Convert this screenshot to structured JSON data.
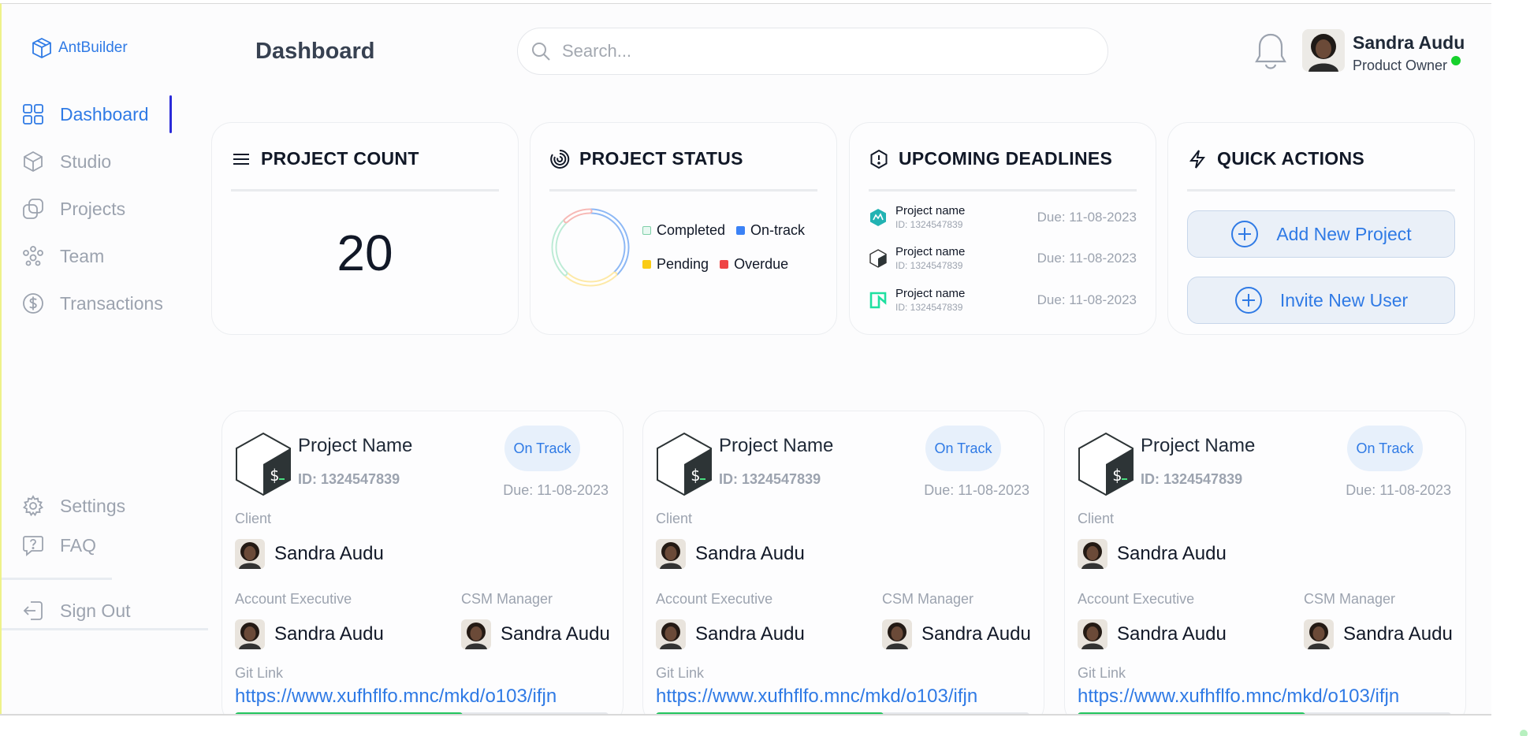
{
  "brand": {
    "name": "AntBuilder",
    "accent": "#2f7ae5"
  },
  "header": {
    "title": "Dashboard"
  },
  "search": {
    "placeholder": "Search..."
  },
  "user": {
    "name": "Sandra Audu",
    "role": "Product Owner",
    "status_color": "#16d12c"
  },
  "sidebar": {
    "items": [
      {
        "label": "Dashboard",
        "icon": "grid-icon",
        "active": true
      },
      {
        "label": "Studio",
        "icon": "cube-icon"
      },
      {
        "label": "Projects",
        "icon": "projects-icon"
      },
      {
        "label": "Team",
        "icon": "team-icon"
      },
      {
        "label": "Transactions",
        "icon": "dollar-icon"
      }
    ],
    "settings": "Settings",
    "faq": "FAQ",
    "signout": "Sign Out"
  },
  "cards": {
    "count": {
      "title": "PROJECT COUNT",
      "value": "20"
    },
    "status": {
      "title": "PROJECT STATUS",
      "legend": [
        {
          "label": "Completed",
          "color": "#a7e8c8"
        },
        {
          "label": "On-track",
          "color": "#3b82f6"
        },
        {
          "label": "Pending",
          "color": "#facc15"
        },
        {
          "label": "Overdue",
          "color": "#ef4444"
        }
      ],
      "segments": [
        {
          "label": "On-track",
          "fraction": 0.38,
          "color": "#8db8f5"
        },
        {
          "label": "Pending",
          "fraction": 0.24,
          "color": "#fde9a8"
        },
        {
          "label": "Completed",
          "fraction": 0.26,
          "color": "#bdebd6"
        },
        {
          "label": "Overdue",
          "fraction": 0.12,
          "color": "#f7b9b6"
        }
      ]
    },
    "deadlines": {
      "title": "UPCOMING DEADLINES",
      "items": [
        {
          "name": "Project name",
          "id": "ID: 1324547839",
          "due": "Due: 11-08-2023",
          "icon": "teal-logo-icon"
        },
        {
          "name": "Project name",
          "id": "ID: 1324547839",
          "due": "Due: 11-08-2023",
          "icon": "bash-logo-icon"
        },
        {
          "name": "Project name",
          "id": "ID: 1324547839",
          "due": "Due: 11-08-2023",
          "icon": "neon-logo-icon"
        }
      ]
    },
    "quick_actions": {
      "title": "QUICK ACTIONS",
      "add_project": "Add New Project",
      "invite_user": "Invite New User"
    }
  },
  "projects": [
    {
      "name": "Project Name",
      "id": "ID: 1324547839",
      "status": "On Track",
      "due": "Due: 11-08-2023",
      "client_label": "Client",
      "client": "Sandra Audu",
      "ae_label": "Account Executive",
      "ae": "Sandra Audu",
      "csm_label": "CSM Manager",
      "csm": "Sandra Audu",
      "git_label": "Git Link",
      "git": "https://www.xufhflfo.mnc/mkd/o103/ifjn",
      "progress": 0.61
    },
    {
      "name": "Project Name",
      "id": "ID: 1324547839",
      "status": "On Track",
      "due": "Due: 11-08-2023",
      "client_label": "Client",
      "client": "Sandra Audu",
      "ae_label": "Account Executive",
      "ae": "Sandra Audu",
      "csm_label": "CSM Manager",
      "csm": "Sandra Audu",
      "git_label": "Git Link",
      "git": "https://www.xufhflfo.mnc/mkd/o103/ifjn",
      "progress": 0.61
    },
    {
      "name": "Project Name",
      "id": "ID: 1324547839",
      "status": "On Track",
      "due": "Due: 11-08-2023",
      "client_label": "Client",
      "client": "Sandra Audu",
      "ae_label": "Account Executive",
      "ae": "Sandra Audu",
      "csm_label": "CSM Manager",
      "csm": "Sandra Audu",
      "git_label": "Git Link",
      "git": "https://www.xufhflfo.mnc/mkd/o103/ifjn",
      "progress": 0.61
    }
  ]
}
